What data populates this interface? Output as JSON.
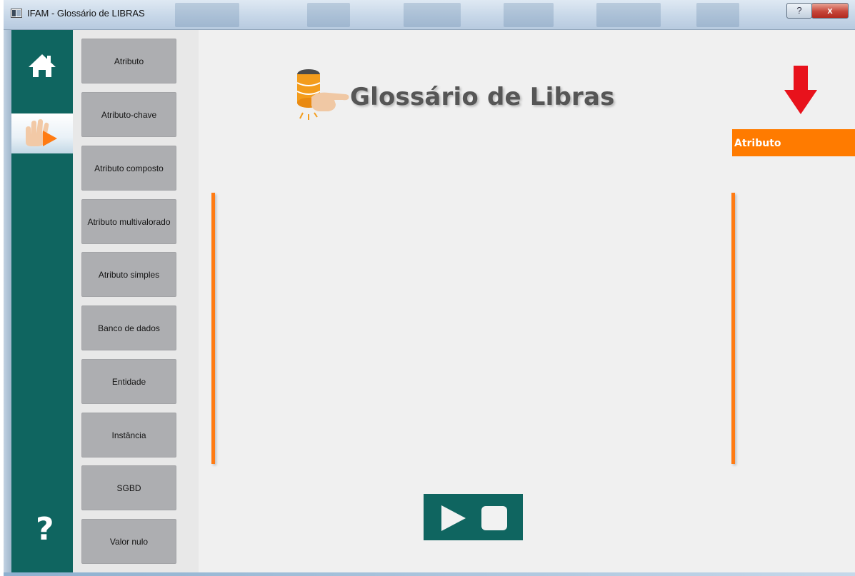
{
  "window": {
    "title": "IFAM - Glossário de LIBRAS",
    "help_glyph": "?",
    "close_glyph": "x"
  },
  "nav": {
    "home_icon": "home-icon",
    "signs_icon": "hand-play-icon",
    "help_icon": "question-icon"
  },
  "terms": [
    "Atributo",
    "Atributo-chave",
    "Atributo composto",
    "Atributo multivalorado",
    "Atributo simples",
    "Banco de dados",
    "Entidade",
    "Instância",
    "SGBD",
    "Valor nulo"
  ],
  "header": {
    "logo_icon": "database-hand-icon",
    "title": "Glossário de Libras"
  },
  "viewer": {
    "indicator_icon": "red-down-arrow-icon",
    "current_term": "Atributo"
  },
  "player": {
    "play_icon": "play-icon",
    "stop_icon": "stop-icon"
  },
  "colors": {
    "teal": "#0f6560",
    "orange": "#ff7b00",
    "term_button": "#adaeb1",
    "arrow_red": "#e8121c"
  }
}
